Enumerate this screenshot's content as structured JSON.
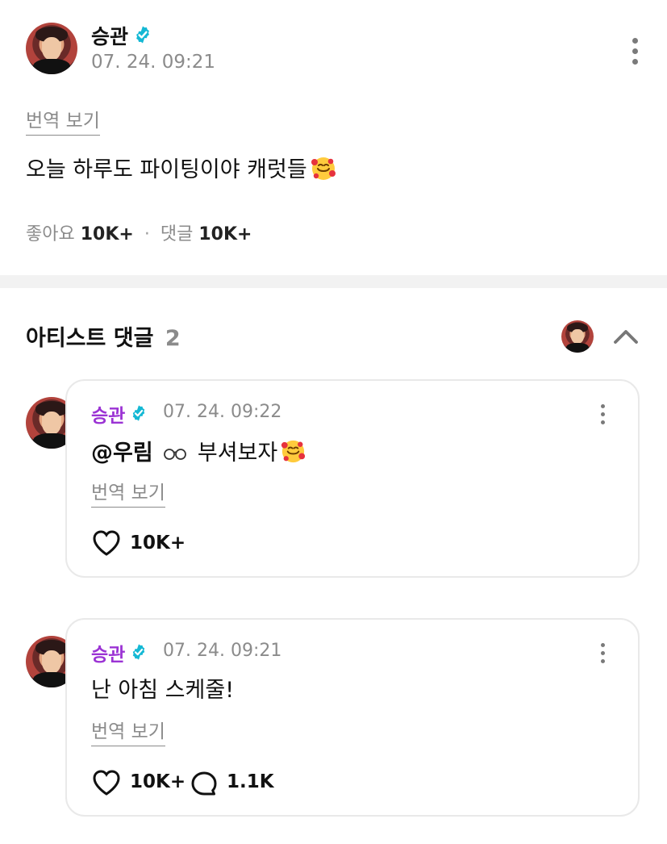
{
  "post": {
    "author": "승관",
    "timestamp": "07. 24. 09:21",
    "translate_label": "번역 보기",
    "text": "오늘 하루도 파이팅이야 캐럿들",
    "likes_label": "좋아요",
    "likes_count": "10K+",
    "separator": "·",
    "comments_label": "댓글",
    "comments_count": "10K+"
  },
  "artist_comments": {
    "title": "아티스트 댓글",
    "count": "2",
    "items": [
      {
        "author": "승관",
        "timestamp": "07. 24. 09:22",
        "mention": "@우림",
        "text": "부셔보자",
        "translate_label": "번역 보기",
        "likes": "10K+"
      },
      {
        "author": "승관",
        "timestamp": "07. 24. 09:21",
        "text": "난 아침 스케줄!",
        "translate_label": "번역 보기",
        "likes": "10K+",
        "replies": "1.1K"
      }
    ]
  },
  "icons": {
    "verified": "verified-badge-icon",
    "more": "more-vertical-icon",
    "collapse": "chevron-up-icon",
    "heart": "heart-icon",
    "reply": "comment-bubble-icon",
    "emoji": "smiling-face-with-hearts-icon"
  },
  "colors": {
    "verified": "#14b8d4",
    "artist_name": "#9b33d4",
    "muted": "#8b8b8b"
  }
}
